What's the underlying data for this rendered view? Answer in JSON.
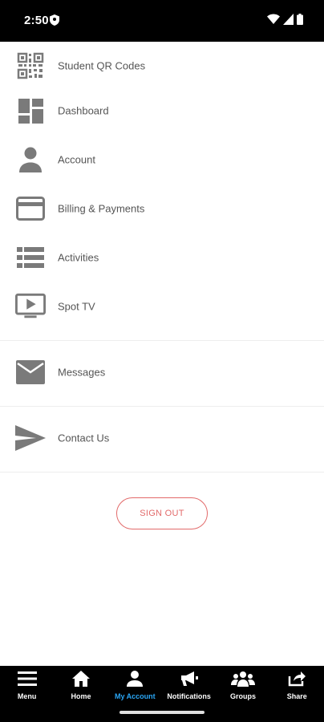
{
  "status_bar": {
    "time": "2:50"
  },
  "menu": {
    "items": [
      {
        "label": "Student QR Codes",
        "icon": "qr-code-icon"
      },
      {
        "label": "Dashboard",
        "icon": "dashboard-icon"
      },
      {
        "label": "Account",
        "icon": "person-icon"
      },
      {
        "label": "Billing & Payments",
        "icon": "credit-card-icon"
      },
      {
        "label": "Activities",
        "icon": "list-icon"
      },
      {
        "label": "Spot TV",
        "icon": "tv-play-icon"
      },
      {
        "label": "Messages",
        "icon": "envelope-icon"
      },
      {
        "label": "Contact Us",
        "icon": "send-icon"
      }
    ]
  },
  "signout": {
    "label": "SIGN OUT"
  },
  "bottom_nav": {
    "tabs": [
      {
        "label": "Menu",
        "icon": "hamburger-icon"
      },
      {
        "label": "Home",
        "icon": "home-icon"
      },
      {
        "label": "My Account",
        "icon": "person-icon",
        "active": true
      },
      {
        "label": "Notifications",
        "icon": "megaphone-icon"
      },
      {
        "label": "Groups",
        "icon": "groups-icon"
      },
      {
        "label": "Share",
        "icon": "share-icon"
      }
    ]
  },
  "colors": {
    "accent": "#2aa6f5",
    "signout": "#e26a6a",
    "icon_gray": "#7a7a7a"
  }
}
